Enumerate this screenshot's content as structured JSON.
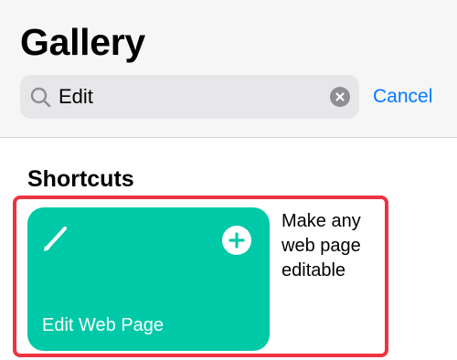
{
  "header": {
    "title": "Gallery"
  },
  "search": {
    "value": "Edit",
    "cancel_label": "Cancel"
  },
  "section": {
    "title": "Shortcuts"
  },
  "shortcut": {
    "title": "Edit Web Page",
    "description": "Make any web page editable"
  },
  "colors": {
    "card": "#00c9a7",
    "accent": "#007aff",
    "highlight": "#ee3340"
  },
  "icons": {
    "search": "search-icon",
    "clear": "clear-icon",
    "pencil": "pencil-icon",
    "add": "plus-icon"
  }
}
